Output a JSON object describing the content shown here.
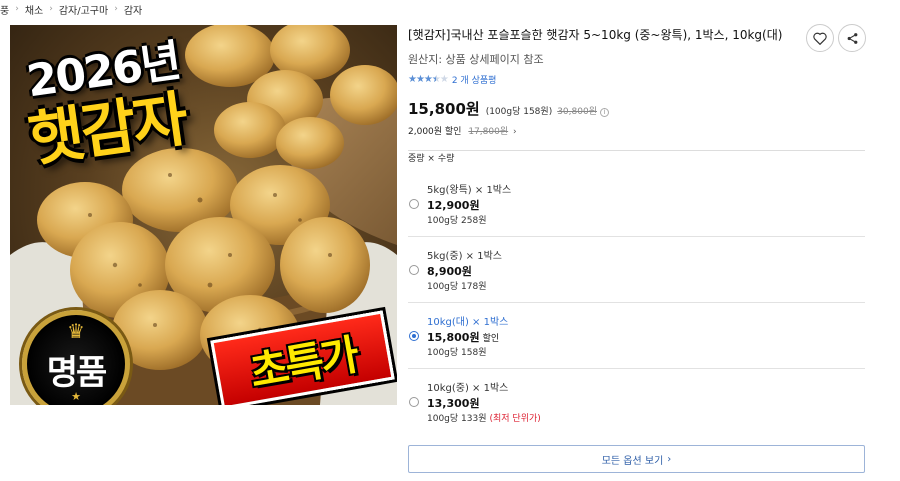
{
  "breadcrumb": [
    "풍",
    "채소",
    "감자/고구마",
    "감자"
  ],
  "image": {
    "year_text": "2026년",
    "headline_text": "햇감자",
    "medal_text": "명품",
    "sale_text": "초특가"
  },
  "product": {
    "title": "[햇감자]국내산 포슬포슬한 햇감자 5~10kg (중~왕특), 1박스, 10kg(대)",
    "origin": "원산지: 상품 상세페이지 참조",
    "rating": 3.5,
    "review_count": "2 개 상품평",
    "price": "15,800원",
    "unit_price": "(100g당 158원)",
    "original_price": "30,800원",
    "discount": "2,000원 할인",
    "discount_old": "17,800원",
    "discount_chevron": "›"
  },
  "options": {
    "label": "중량 × 수량",
    "items": [
      {
        "name": "5kg(왕특) × 1박스",
        "price": "12,900원",
        "tag": "",
        "unit": "100g당 258원",
        "note": "",
        "selected": false
      },
      {
        "name": "5kg(중) × 1박스",
        "price": "8,900원",
        "tag": "",
        "unit": "100g당 178원",
        "note": "",
        "selected": false
      },
      {
        "name": "10kg(대) × 1박스",
        "price": "15,800원",
        "tag": "할인",
        "unit": "100g당 158원",
        "note": "",
        "selected": true
      },
      {
        "name": "10kg(중) × 1박스",
        "price": "13,300원",
        "tag": "",
        "unit": "100g당 133원",
        "note": "(최저 단위가)",
        "selected": false
      }
    ],
    "all_button": "모든 옵션 보기",
    "all_button_chevron": "›"
  },
  "icons": {
    "heart": "heart-icon",
    "share": "share-icon",
    "info": "info-icon"
  },
  "colors": {
    "accent_blue": "#2f6fd1",
    "lowest_price_red": "#dd2233",
    "star_blue": "#5b8fd6"
  }
}
